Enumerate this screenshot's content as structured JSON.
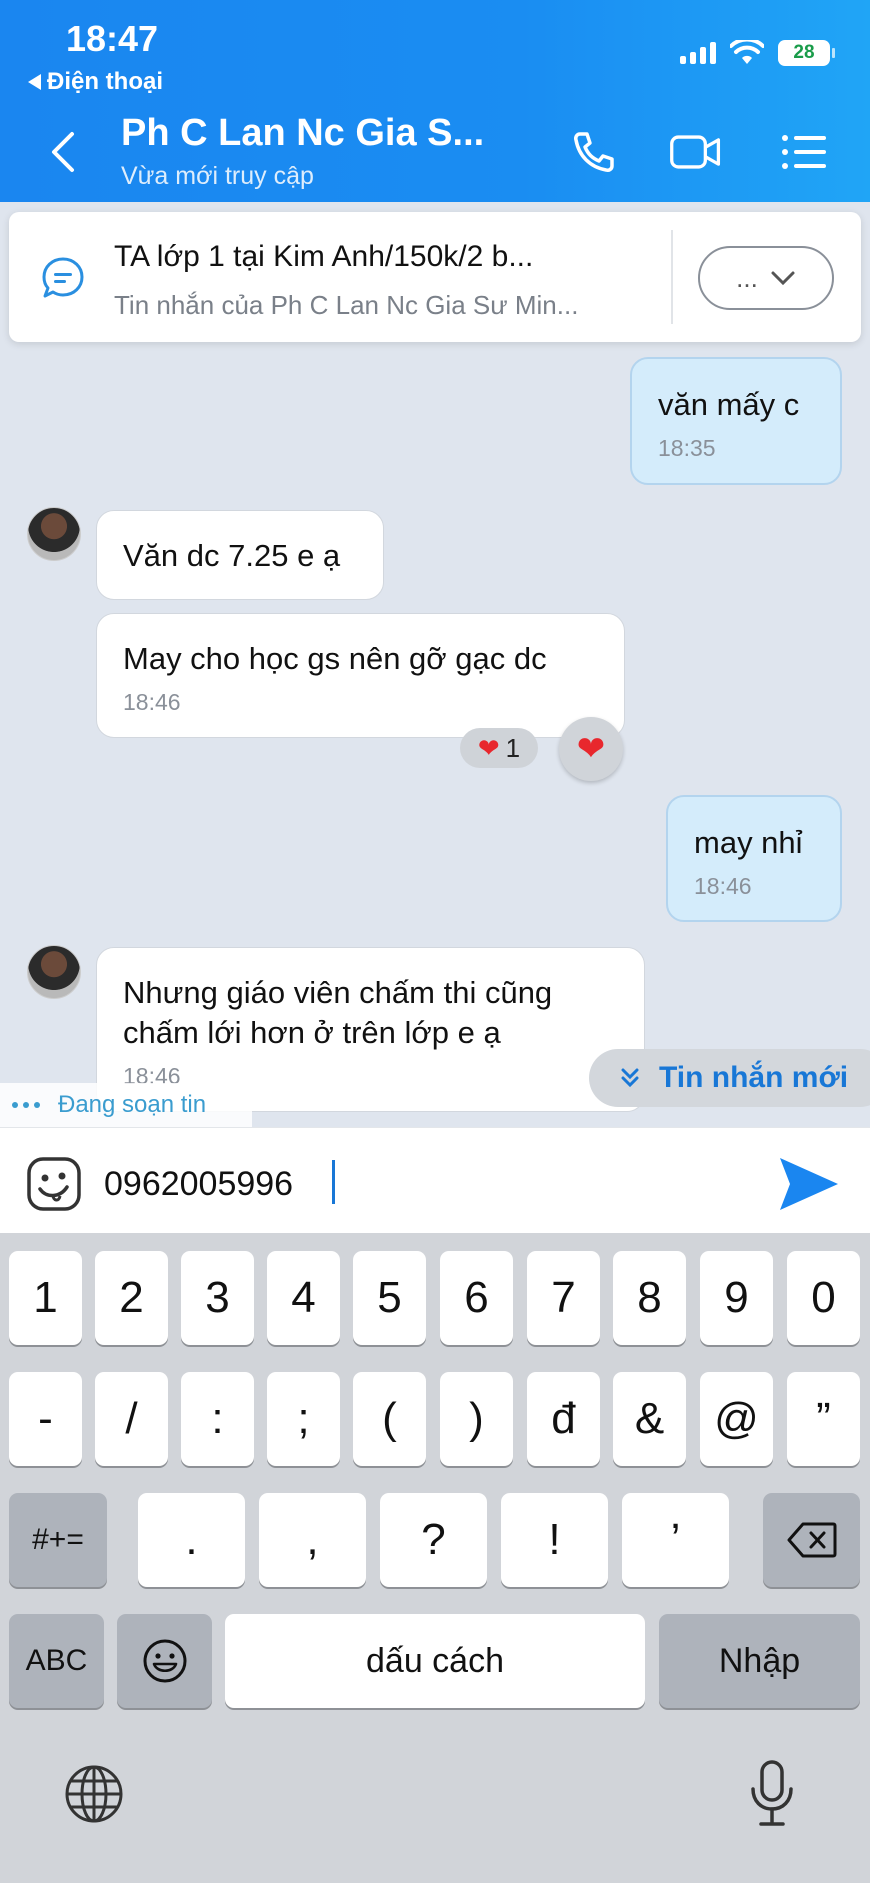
{
  "status_bar": {
    "time": "18:47",
    "back_app": "Điện thoại",
    "battery": "28"
  },
  "header": {
    "contact_name": "Ph C Lan Nc Gia S...",
    "contact_status": "Vừa mới truy cập"
  },
  "pinned": {
    "title": "TA lớp 1 tại Kim Anh/150k/2 b...",
    "subtitle": "Tin nhắn của Ph C Lan Nc Gia Sư Min...",
    "more_label": "..."
  },
  "messages": [
    {
      "direction": "out",
      "text": "văn mấy c",
      "time": "18:35"
    },
    {
      "direction": "in",
      "text": "Văn dc 7.25 e ạ"
    },
    {
      "direction": "in",
      "text": "May cho học gs nên gỡ gạc dc",
      "time": "18:46",
      "reaction_count": "1"
    },
    {
      "direction": "out",
      "text": "may nhỉ",
      "time": "18:46"
    },
    {
      "direction": "in",
      "text_line1": "Nhưng giáo viên chấm thi cũng",
      "text_line2": "chấm lới hơn ở trên lớp e ạ",
      "time": "18:46"
    }
  ],
  "new_messages_label": "Tin nhắn mới",
  "typing_indicator": "Đang soạn tin",
  "composer": {
    "value": "0962005996"
  },
  "keyboard": {
    "row1": [
      "1",
      "2",
      "3",
      "4",
      "5",
      "6",
      "7",
      "8",
      "9",
      "0"
    ],
    "row2": [
      "-",
      "/",
      ":",
      ";",
      "(",
      ")",
      "đ",
      "&",
      "@",
      "”"
    ],
    "row3": [
      "#+=",
      ".",
      ",",
      "?",
      "!",
      "’"
    ],
    "abc": "ABC",
    "space": "dấu cách",
    "enter": "Nhập"
  },
  "colors": {
    "header": "#1a8df2",
    "outgoing_bubble": "#d4ecfb",
    "accent": "#1877d6"
  }
}
